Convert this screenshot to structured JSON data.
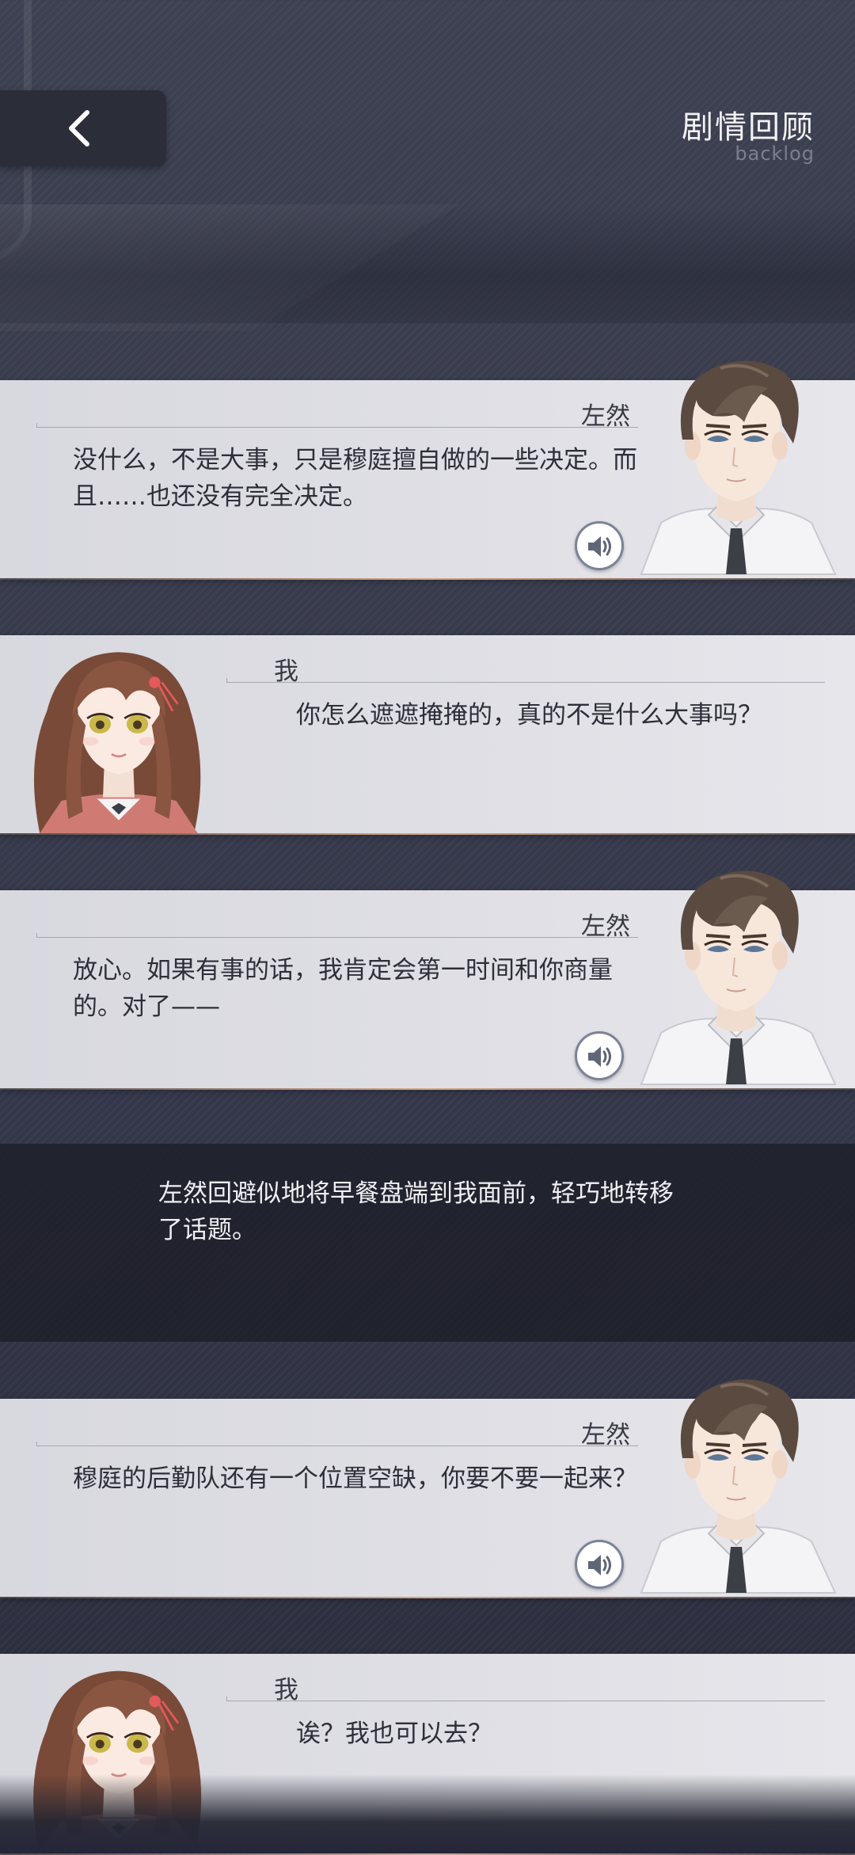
{
  "header": {
    "title": "剧情回顾",
    "subtitle": "backlog",
    "back_icon": "chevron-left-icon"
  },
  "dialogues": [
    {
      "speaker": "左然",
      "text": "没什么，不是大事，只是穆庭擅自做的一些决定。而且……也还没有完全决定。",
      "voice_icon": "speaker-icon"
    },
    {
      "speaker": "我",
      "text": "你怎么遮遮掩掩的，真的不是什么大事吗？"
    },
    {
      "speaker": "左然",
      "text": "放心。如果有事的话，我肯定会第一时间和你商量的。对了——",
      "voice_icon": "speaker-icon"
    },
    {
      "speaker": "左然",
      "text": "穆庭的后勤队还有一个位置空缺，你要不要一起来？",
      "voice_icon": "speaker-icon"
    },
    {
      "speaker": "我",
      "text": "诶？我也可以去？"
    }
  ],
  "narration": {
    "text": "左然回避似地将早餐盘端到我面前，轻巧地转移了话题。"
  },
  "colors": {
    "background": "#3a3d4d",
    "card": "#dfdfe5",
    "accent_line": "#e6b48c"
  }
}
